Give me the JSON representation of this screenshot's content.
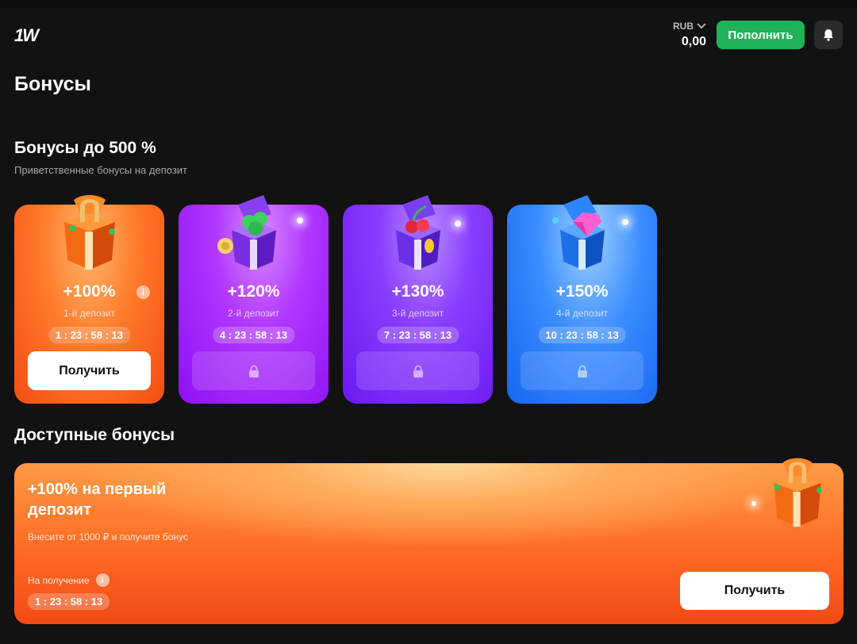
{
  "header": {
    "logo": "1W",
    "currency": "RUB",
    "balance": "0,00",
    "deposit_label": "Пополнить"
  },
  "page": {
    "title": "Бонусы"
  },
  "welcome": {
    "title": "Бонусы до 500 %",
    "subtitle": "Приветственные бонусы на депозит",
    "cards": [
      {
        "percent": "+100%",
        "deposit": "1-й депозит",
        "timer": "1 : 23 : 58 : 13",
        "button": "Получить",
        "icon": "orange-gift-horseshoe"
      },
      {
        "percent": "+120%",
        "deposit": "2-й депозит",
        "timer": "4 : 23 : 58 : 13",
        "icon": "purple-gift-clover"
      },
      {
        "percent": "+130%",
        "deposit": "3-й депозит",
        "timer": "7 : 23 : 58 : 13",
        "icon": "purple-gift-cherry"
      },
      {
        "percent": "+150%",
        "deposit": "4-й депозит",
        "timer": "10 : 23 : 58 : 13",
        "icon": "blue-gift-diamond"
      }
    ]
  },
  "available": {
    "title": "Доступные бонусы",
    "promo": {
      "title": "+100% на первый депозит",
      "description": "Внесите от 1000 ₽ и получите бонус",
      "receive_label": "На получение",
      "timer": "1 : 23 : 58 : 13",
      "button": "Получить"
    }
  },
  "colors": {
    "background": "#121212",
    "accent_green": "#1fb25a",
    "orange": "#ff6a24",
    "purple": "#a12cff",
    "violet": "#7a2cff",
    "blue": "#2b7cff"
  }
}
